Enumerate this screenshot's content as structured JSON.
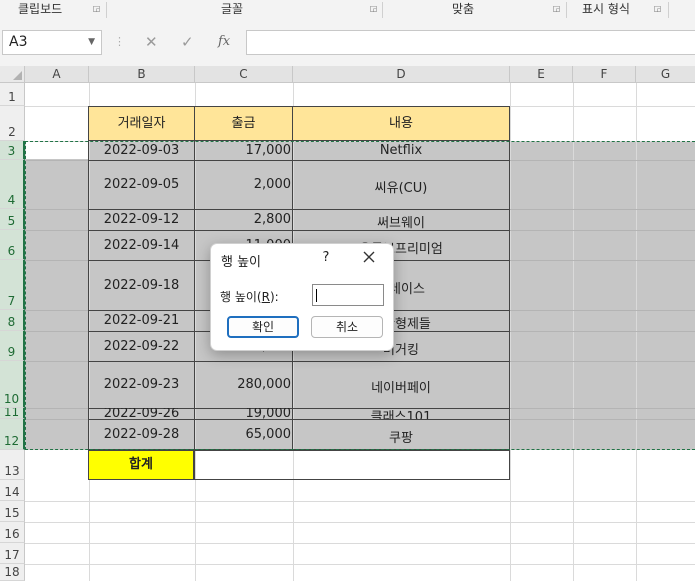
{
  "ribbon": {
    "groups": [
      {
        "label": "클립보드"
      },
      {
        "label": "글꼴"
      },
      {
        "label": "맞춤"
      },
      {
        "label": "표시 형식"
      }
    ]
  },
  "formula_bar": {
    "name_box": "A3",
    "formula": ""
  },
  "columns": [
    "A",
    "B",
    "C",
    "D",
    "E",
    "F",
    "G"
  ],
  "rows": [
    "1",
    "2",
    "3",
    "4",
    "5",
    "6",
    "7",
    "8",
    "9",
    "10",
    "11",
    "12",
    "13",
    "14",
    "15",
    "16",
    "17",
    "18"
  ],
  "table": {
    "headers": [
      "거래일자",
      "출금",
      "내용"
    ],
    "rows": [
      {
        "date": "2022-09-03",
        "amount": "17,000",
        "desc": "Netflix"
      },
      {
        "date": "2022-09-05",
        "amount": "2,000",
        "desc": "씨유(CU)"
      },
      {
        "date": "2022-09-12",
        "amount": "2,800",
        "desc": "써브웨이"
      },
      {
        "date": "2022-09-14",
        "amount": "11,000",
        "desc": "유튜브프리미엄"
      },
      {
        "date": "2022-09-18",
        "amount": "",
        "desc": "플레이스"
      },
      {
        "date": "2022-09-21",
        "amount": "",
        "desc": "아한형제들"
      },
      {
        "date": "2022-09-22",
        "amount": "8,700",
        "desc": "버거킹"
      },
      {
        "date": "2022-09-23",
        "amount": "280,000",
        "desc": "네이버페이"
      },
      {
        "date": "2022-09-26",
        "amount": "19,000",
        "desc": "클래스101"
      },
      {
        "date": "2022-09-28",
        "amount": "65,000",
        "desc": "쿠팡"
      }
    ],
    "sum_label": "합계"
  },
  "dialog": {
    "title": "행 높이",
    "help": "?",
    "field_label_pre": "행 높이(",
    "field_label_key": "R",
    "field_label_post": "):",
    "value": "",
    "ok": "확인",
    "cancel": "취소"
  },
  "colors": {
    "header_fill": "#ffe599",
    "sum_fill": "#ffff00",
    "selection_fill": "#c6c6c6",
    "accent": "#217346"
  }
}
